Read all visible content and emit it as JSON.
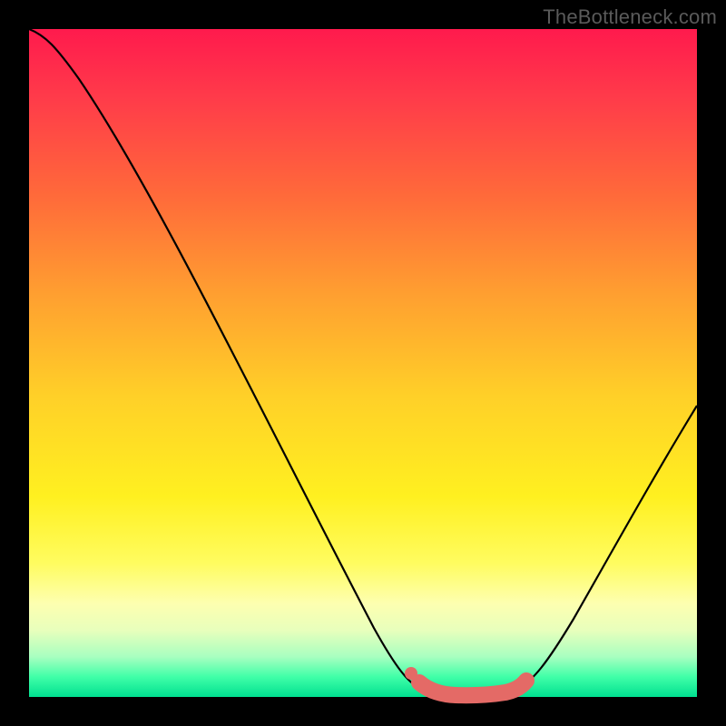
{
  "watermark": "TheBottleneck.com",
  "colors": {
    "curve": "#000000",
    "highlight": "#e46a66",
    "highlight_dot": "#e46a66",
    "gradient_top": "#ff1a4d",
    "gradient_bottom": "#00e090"
  },
  "chart_data": {
    "type": "line",
    "title": "",
    "xlabel": "",
    "ylabel": "",
    "xlim": [
      0,
      100
    ],
    "ylim": [
      0,
      100
    ],
    "grid": false,
    "series": [
      {
        "name": "bottleneck-curve",
        "x": [
          0,
          5,
          10,
          15,
          20,
          25,
          30,
          35,
          40,
          45,
          50,
          55,
          57,
          60,
          63,
          67,
          70,
          73,
          75,
          80,
          85,
          90,
          95,
          100
        ],
        "values": [
          100,
          99,
          93,
          85,
          76,
          67,
          58,
          49,
          40,
          31,
          22,
          13,
          7,
          2,
          0.5,
          0,
          0,
          0.5,
          1.5,
          6,
          14,
          24,
          34,
          44
        ]
      }
    ],
    "highlight": {
      "name": "optimal-range",
      "x_range": [
        57,
        75
      ],
      "values_at_range": [
        1.2,
        0.5,
        0,
        0,
        0,
        0.5,
        1.2
      ]
    }
  }
}
